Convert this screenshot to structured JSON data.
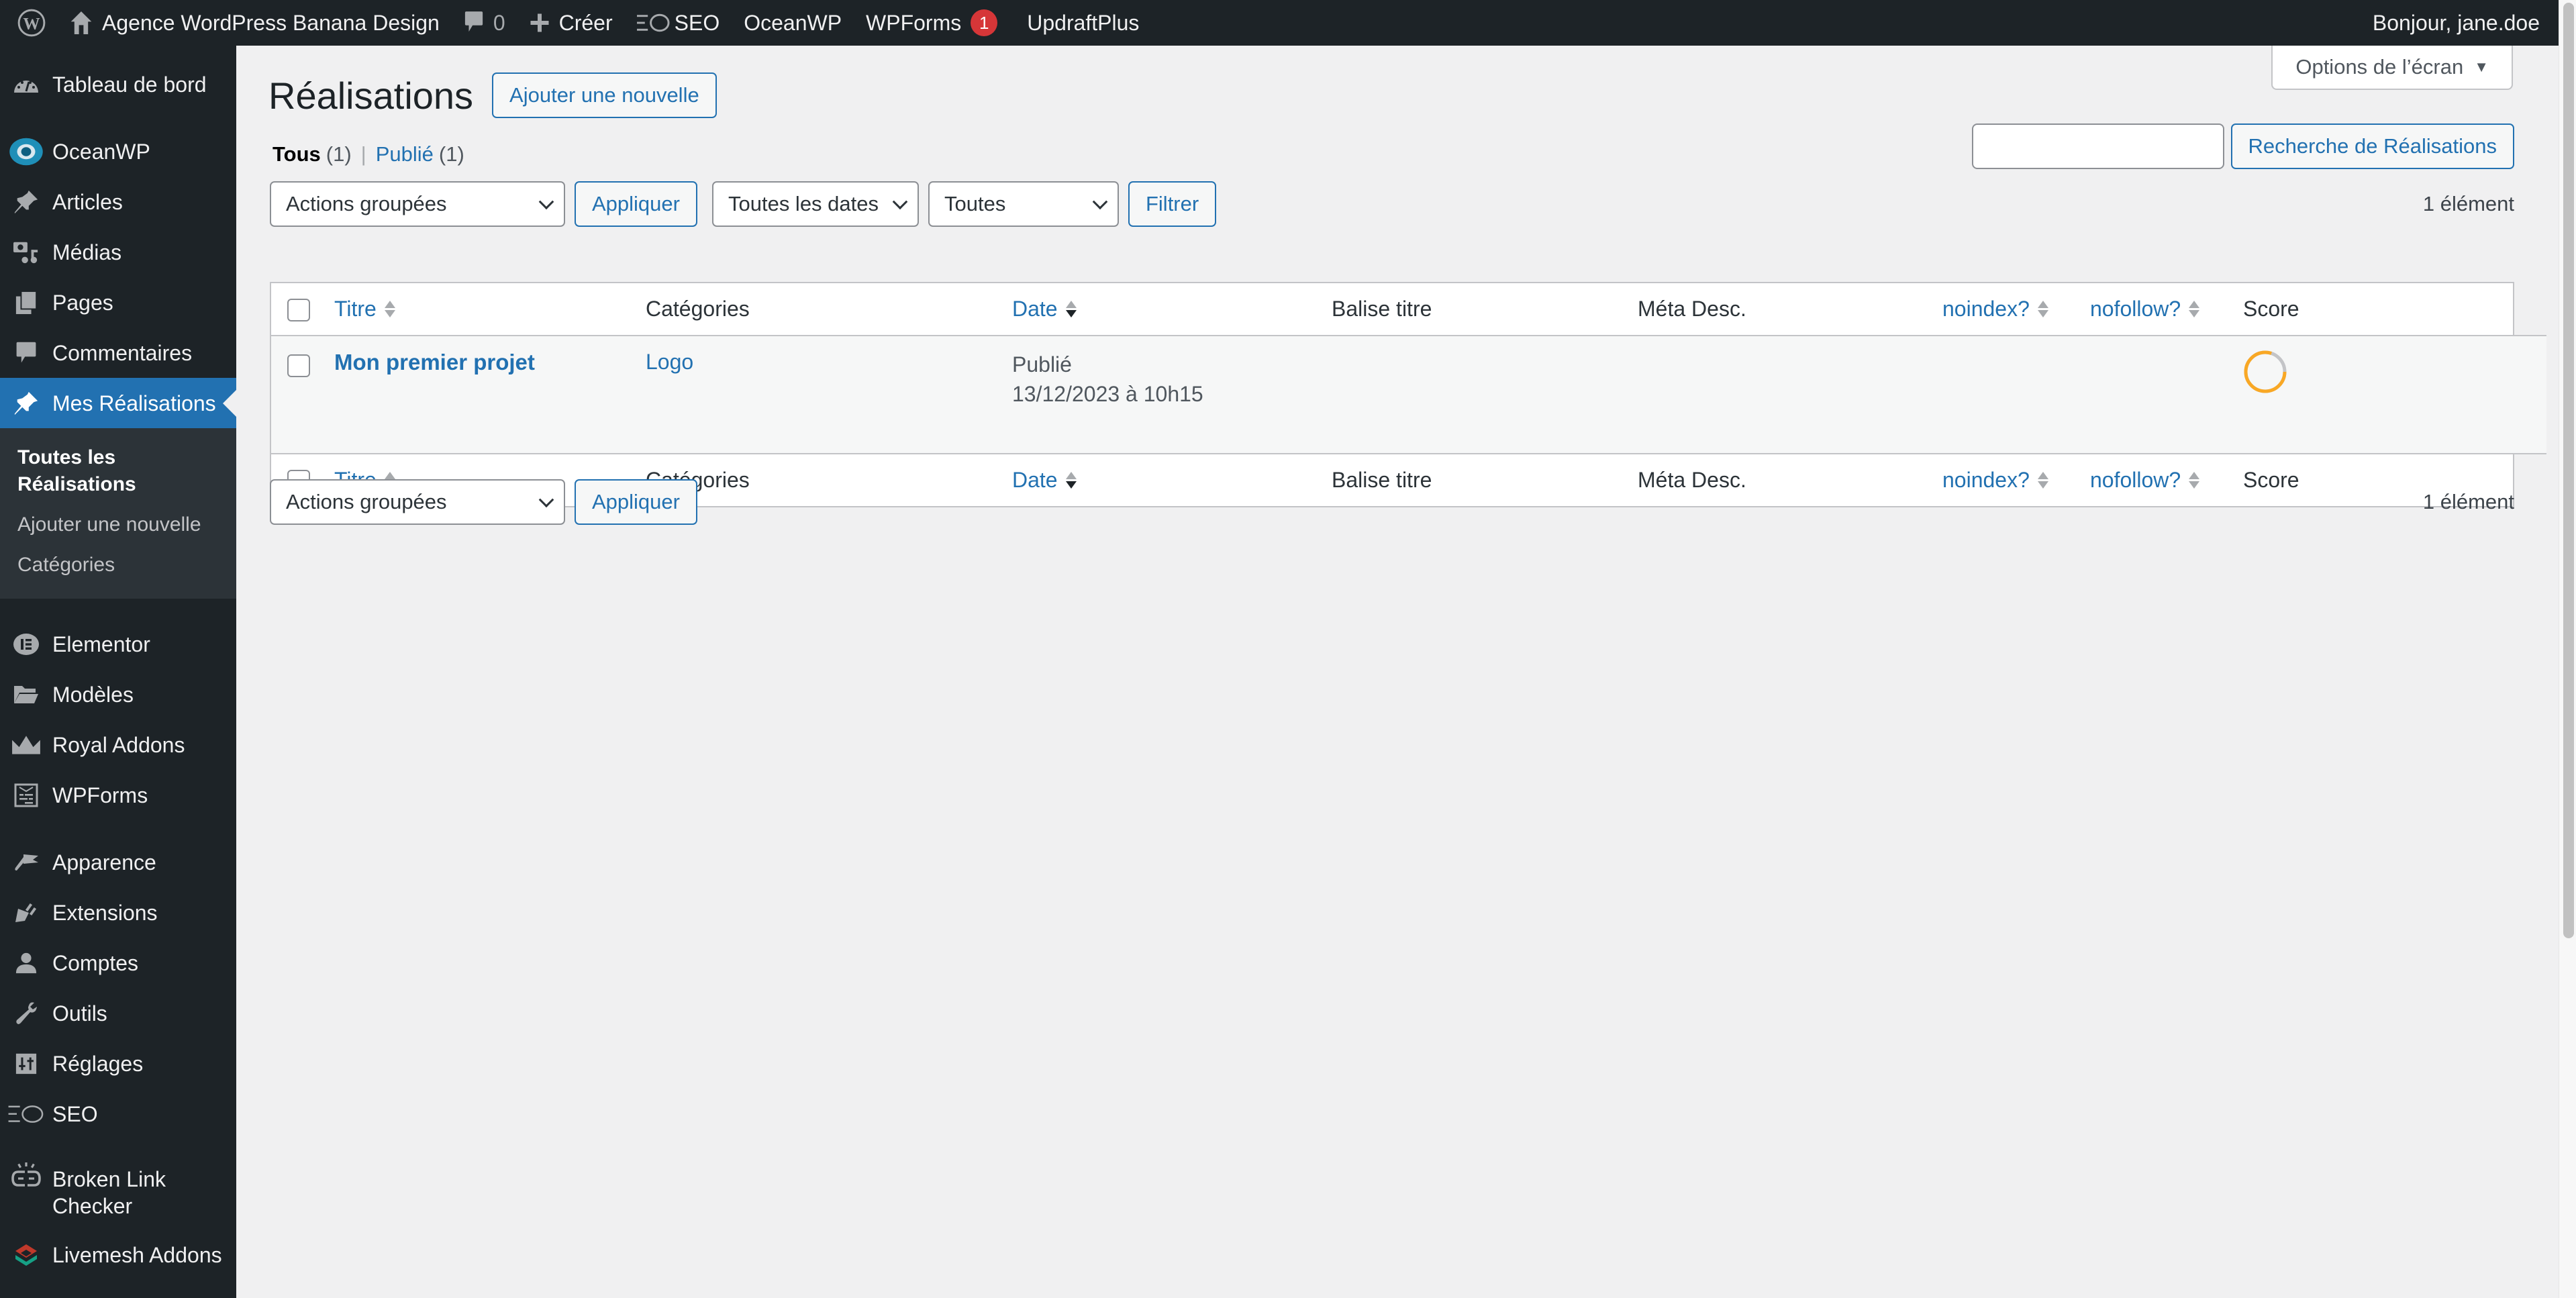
{
  "adminbar": {
    "site_name": "Agence WordPress Banana Design",
    "comments_count": "0",
    "new_label": "Créer",
    "seo_label": "SEO",
    "oceanwp_label": "OceanWP",
    "wpforms_label": "WPForms",
    "wpforms_badge": "1",
    "updraft_label": "UpdraftPlus",
    "greeting": "Bonjour, jane.doe"
  },
  "sidebar": {
    "items": [
      {
        "label": "Tableau de bord",
        "icon": "dashboard-icon"
      },
      {
        "label": "OceanWP",
        "icon": "oceanwp-icon"
      },
      {
        "label": "Articles",
        "icon": "pin-icon"
      },
      {
        "label": "Médias",
        "icon": "media-icon"
      },
      {
        "label": "Pages",
        "icon": "pages-icon"
      },
      {
        "label": "Commentaires",
        "icon": "comment-icon"
      },
      {
        "label": "Mes Réalisations",
        "icon": "pin-icon",
        "active": true
      },
      {
        "label": "Elementor",
        "icon": "elementor-icon"
      },
      {
        "label": "Modèles",
        "icon": "folder-icon"
      },
      {
        "label": "Royal Addons",
        "icon": "crown-icon"
      },
      {
        "label": "WPForms",
        "icon": "wpforms-icon"
      },
      {
        "label": "Apparence",
        "icon": "brush-icon"
      },
      {
        "label": "Extensions",
        "icon": "plugin-icon"
      },
      {
        "label": "Comptes",
        "icon": "user-icon"
      },
      {
        "label": "Outils",
        "icon": "wrench-icon"
      },
      {
        "label": "Réglages",
        "icon": "settings-icon"
      },
      {
        "label": "SEO",
        "icon": "seo-icon"
      },
      {
        "label": "Broken Link Checker",
        "icon": "broken-link-icon"
      },
      {
        "label": "Livemesh Addons",
        "icon": "livemesh-icon"
      }
    ],
    "submenu": [
      {
        "label": "Toutes les Réalisations",
        "current": true
      },
      {
        "label": "Ajouter une nouvelle"
      },
      {
        "label": "Catégories"
      }
    ]
  },
  "screen_options_label": "Options de l’écran",
  "page": {
    "title": "Réalisations",
    "add_new_label": "Ajouter une nouvelle"
  },
  "views": {
    "all_label": "Tous",
    "all_count": "(1)",
    "separator": "|",
    "published_label": "Publié",
    "published_count": "(1)"
  },
  "search": {
    "value": "",
    "button_label": "Recherche de Réalisations"
  },
  "tablenav_top": {
    "bulk_actions": "Actions groupées",
    "apply_label": "Appliquer",
    "dates_filter": "Toutes les dates",
    "category_filter": "Toutes",
    "filter_label": "Filtrer",
    "count": "1 élément"
  },
  "tablenav_bottom": {
    "bulk_actions": "Actions groupées",
    "apply_label": "Appliquer",
    "count": "1 élément"
  },
  "table": {
    "columns": [
      {
        "label": "Titre",
        "sortable": true
      },
      {
        "label": "Catégories",
        "sortable": false
      },
      {
        "label": "Date",
        "sortable": true,
        "sorted": "desc"
      },
      {
        "label": "Balise titre",
        "sortable": false
      },
      {
        "label": "Méta Desc.",
        "sortable": false
      },
      {
        "label": "noindex?",
        "sortable": true
      },
      {
        "label": "nofollow?",
        "sortable": true
      },
      {
        "label": "Score",
        "sortable": false
      }
    ],
    "rows": [
      {
        "title": "Mon premier projet",
        "category": "Logo",
        "status": "Publié",
        "date": "13/12/2023 à 10h15",
        "title_tag": "",
        "meta_desc": "",
        "noindex": "",
        "nofollow": "",
        "score_fraction": 0.8,
        "score_color": "#f9a825"
      }
    ]
  },
  "colors": {
    "accent": "#2271b1",
    "adminbar_bg": "#1d2327",
    "badge": "#d63638"
  }
}
